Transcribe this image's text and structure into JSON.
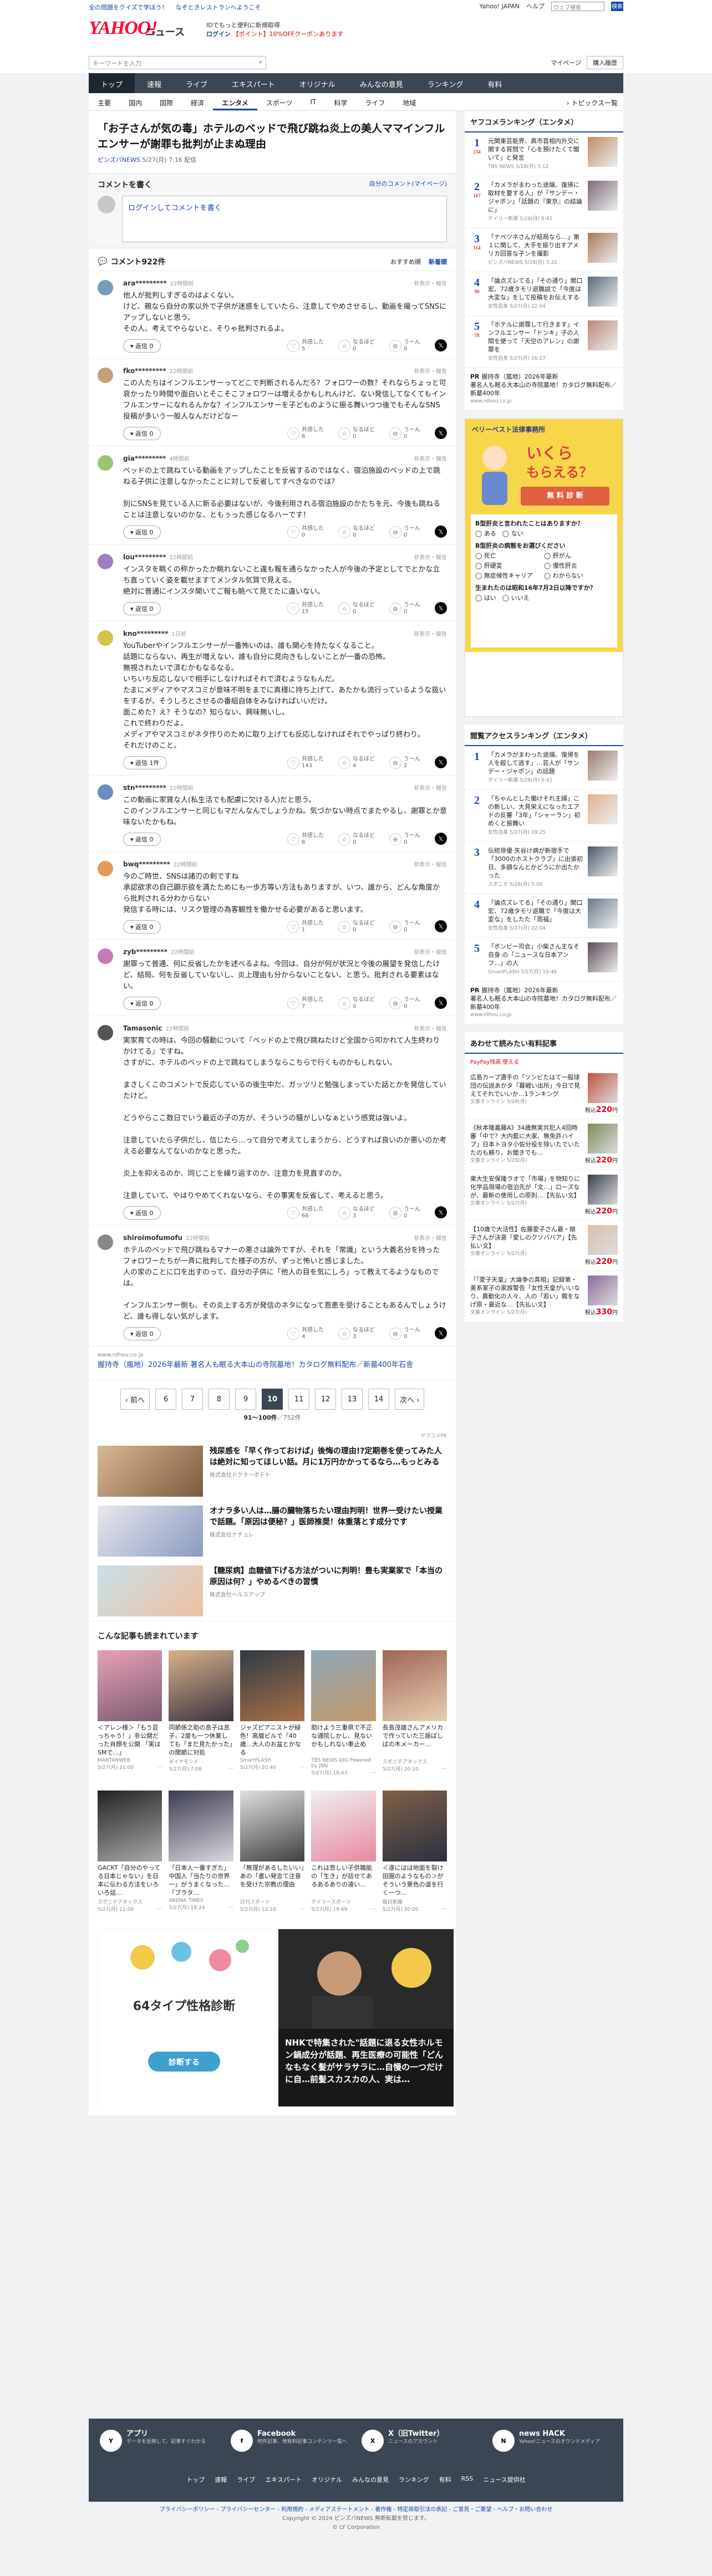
{
  "topbar": {
    "left1": "全の問題をクイズで学ぼう！",
    "left2": "なぞときレストランへようこそ",
    "yj": "Yahoo! JAPAN",
    "help": "ヘルプ",
    "search_placeholder": "ウェブ検索",
    "search_btn": "検索"
  },
  "header": {
    "logo": "YAHOO!",
    "logo_sub": "ニュース",
    "promo_line1": "IDでもっと便利に新規取得",
    "promo_line2_a": "ログイン",
    "promo_line2_b": "【ポイント】10%OFFクーポンあります"
  },
  "search": {
    "placeholder": "キーワードを入力",
    "mypage": "マイページ",
    "setting": "購入履歴"
  },
  "nav1": [
    "トップ",
    "速報",
    "ライブ",
    "エキスパート",
    "オリジナル",
    "みんなの意見",
    "ランキング",
    "有料"
  ],
  "nav1_active": "トップ",
  "nav2": [
    "主要",
    "国内",
    "国際",
    "経済",
    "エンタメ",
    "スポーツ",
    "IT",
    "科学",
    "ライフ",
    "地域"
  ],
  "nav2_active": "エンタメ",
  "nav2_more": "トピックス一覧",
  "article": {
    "title": "「お子さんが気の毒」ホテルのベッドで飛び跳ね炎上の美人ママインフルエンサーが謝罪も批判が止まぬ理由",
    "source": "ピンズバNEWS",
    "time": "5/27(月) 7:16 配信"
  },
  "comment_write": {
    "heading": "コメントを書く",
    "link": "自分のコメント(マイページ)",
    "placeholder": "ログインしてコメントを書く"
  },
  "comment_list": {
    "heading": "コメント922件",
    "sort_recommended": "おすすめ順",
    "sort_new": "新着順"
  },
  "reaction_labels": {
    "agree": "共感した",
    "insight": "なるほど",
    "disagree": "うーん"
  },
  "reply_label": "返信",
  "flag_label": "非表示・報告",
  "comments": [
    {
      "user": "ara*********",
      "time": "22時間前",
      "text": "他人が批判しすぎるのはよくない。\nけど、親なら自分の家以外で子供が迷惑をしていたら、注意してやめさせるし、動画を撮ってSNSにアップしないと思う。\nその人、考えてやらないと、そりゃ批判されるよ。",
      "replies": "返信 0",
      "agree": "5",
      "insight": "0",
      "disagree": "0",
      "color": "#7a9bb8"
    },
    {
      "user": "fko*********",
      "time": "22時間前",
      "text": "この人たちはインフルエンサーってどこで判断されるんだろ？フォロワーの数？それならちょっと可哀かったり時間や面白いとそこそこフォロワーは増えるかもしれんけど、ない発信してなくてもインフルエンサーになれるんかな？インフルエンサーを子どものように振る舞いつつ後でもそんなSNS投稿が多いう一般人なんだけどなー",
      "replies": "返信 0",
      "agree": "6",
      "insight": "0",
      "disagree": "0",
      "color": "#c6a076"
    },
    {
      "user": "gia*********",
      "time": "4時間前",
      "text": "ベッドの上で跳ねている動画をアップしたことを反省するのではなく、宿泊施設のベッドの上で跳ねる子供に注意しなかったことに対して反省してすべきなのでは？\n\n別にSNSを見ている人に新る必要はないが、今後利用される宿泊施設のかたちを元、今後も跳ねることは注意しないのかな、ともぅった感じなるハーです！",
      "replies": "返信 0",
      "agree": "0",
      "insight": "0",
      "disagree": "0",
      "color": "#9ac46e"
    },
    {
      "user": "lou*********",
      "time": "22時間前",
      "text": "インスタを眺くの称かったか眺れないこと違も報を通らなかった人が今後の予定としてでとかな立ち直っていく姿を載せますてメンタル気質で見える。\n絶対に普通にインスタ開いてご報も眺べて見てたに違いない。",
      "replies": "返信 0",
      "agree": "15",
      "insight": "0",
      "disagree": "0",
      "color": "#a07ec0"
    },
    {
      "user": "kno*********",
      "time": "1日前",
      "text": "YouTuberやインフルエンサーが一番怖いのは、誰も関心を持たなくなること。\n話題にならない、再生が増えない、誰も自分に見向きもしないことが一番の恐怖。\n無視されたいで済むかもなるなる。\nいちいち反応しないで相手にしなければそれで済むようなもんだ。\nたまにメディアやマスコミが意味不明をまでに真様に持ち上げて、あたかも流行っているような扱いをするが、そうしろとさせるの番組自体をみなければいいだけ。\n面こめた？え？そうなの？知らない、興味無いし。\nこれで終わりだよ。\nメディアやマスコミがネタ作りのために取り上げても反応しなければそれでやっぱり終わり。\nそれだけのこと。",
      "replies": "返信 1件",
      "agree": "143",
      "insight": "4",
      "disagree": "2",
      "color": "#d4c24c"
    },
    {
      "user": "stn*********",
      "time": "22時間前",
      "text": "この動画に家賃な人(私生活でも配慮に欠ける人)だと思う。\nこのインフルエンサーと同じもマだんなんでしょうかね。気づかない時点でまたやるし、謝罪とか意味ないたかもね。",
      "replies": "返信 0",
      "agree": "8",
      "insight": "0",
      "disagree": "0",
      "color": "#6b8ebf"
    },
    {
      "user": "bwq*********",
      "time": "22時間前",
      "text": "今のご時世、SNSは諸刃の剣ですね\n承認欲求の自己顕示欲を満たためにも一歩方等い方法もありますが、いつ、誰から、どんな角度から批判される分わからない\n発信する時には、リスク管理の為客観性を働かせる必要があると思います。",
      "replies": "返信 0",
      "agree": "1",
      "insight": "0",
      "disagree": "0",
      "color": "#e39a5a"
    },
    {
      "user": "zyb*********",
      "time": "22時間前",
      "text": "謝罪って普通、何に反省したかを述べるよね。今回は、自分が何が状況と今後の展望を発信したけど、結局、何を反省していないし、炎上理由も分からないことない、と思う。批判される要素はない。",
      "replies": "返信 0",
      "agree": "7",
      "insight": "0",
      "disagree": "0",
      "color": "#c678b8"
    },
    {
      "user": "Tamasonic",
      "time": "22時間前",
      "text": "実家育ての時は、今回の騒動について『ベッドの上で飛び跳ねたけど全国から叩かれて人生終わりかけてる』ですね。\nさすがに、ホテルのベッドの上で跳ねてしまうならこちらで行くものかもしれない。\n\nまさしくこのコメントで反応しているの後生中だ、ガッツリと勉強しまっていた話とかを発信していたけど。\n\nどうやらここ数日でいう最近の子の方が、そういうの騒がしいなぁという感覚は強いよ。\n\n注意していたら子供だし、信じたら…って自分で考えてしまうから、どうすれば良いのか悪いのか考える必要なんてないのかなと思った。\n\n炎上を抑えるのか、同じことを繰り返すのか、注意力を見直すのか。\n\n注意していて、やはりやめてくれないなら、その事実を反省して、考えると思う。",
      "replies": "返信 0",
      "agree": "66",
      "insight": "3",
      "disagree": "0",
      "color": "#555"
    },
    {
      "user": "shiroimofumofu",
      "time": "22時間前",
      "text": "ホテルのベッドで飛び跳ねるマナーの悪さは論外ですが、それを「常識」という大義名分を持ったフォロワーたちが一斉に批判してた様子の方が、ずっと怖いと感じました。\n人の家のことに口を出すのって、自分の子供に「他人の目を気にしろ」って教えてるようなものでは。\n\nインフルエンサー側も、その炎上する方が発信のネタになって恩恵を受けることもあるんでしょうけど、誰も得しない気がします。",
      "replies": "返信 0",
      "agree": "4",
      "insight": "3",
      "disagree": "0",
      "color": "#888"
    }
  ],
  "source_box": {
    "src": "www.rdhou.co.jp",
    "link": "握持寺（嵐地）2026年最新 著名人も眠る大本山の寺院墓地！カタログ無料配布／新墓400年石舎"
  },
  "pager": {
    "prev": "前へ",
    "pages": [
      "6",
      "7",
      "8",
      "9",
      "10",
      "11",
      "12",
      "13",
      "14"
    ],
    "current": "10",
    "next": "次へ",
    "info_range": "91〜100件",
    "info_total": "／752件"
  },
  "ad_label": "ヤフコメPR",
  "ads": [
    {
      "title": "残尿感を「早く作っておけば」後悔の理由!?定期巻を使ってみた人は絶対に知ってほしい話。月に1万円かかってるなら…もっとみる",
      "sponsor": "株式会社ドクターポテト"
    },
    {
      "title": "オナラ多い人は…腸の臓物落ちたい理由判明！世界一受けたい授業で話題。「原因は便秘？」医師推奨！体重落とす成分です",
      "sponsor": "株式会社ナチュレ"
    },
    {
      "title": "【糖尿病】血糖値下げる方法がついに判明！豊も実業家で「本当の原因は何？」やめるべきの習慣",
      "sponsor": "株式会社ヘルスアップ"
    }
  ],
  "more_heading": "こんな記事も読まれています",
  "more_items": [
    {
      "title": "＜アレン様＞「もう芸っちゃう！」非公開だった肖顔を公開 「実はSMで…」",
      "source": "MANTANWEB",
      "date": "5/27(月) 21:00",
      "c1": "#e8a0b8",
      "c2": "#7a5c6e"
    },
    {
      "title": "同節係之助の息子は息子、2度も一つ休業しても「まだ見たかった」の関節に対処",
      "source": "ダイヤモンド",
      "date": "5/27(月) 7:08",
      "c1": "#d8b28a",
      "c2": "#3b3240"
    },
    {
      "title": "ジャズピアニストが緑色！高層ビルで「40歳…大人のお盆とかなる",
      "source": "SmartFLASH",
      "date": "5/27(月) 20:40",
      "c1": "#303a45",
      "c2": "#a87048"
    },
    {
      "title": "助けよう三重県で不正な通院しかし、見ないかもしれない車止め",
      "source": "TBS NEWS DIG Powered by JNN",
      "date": "5/27(月) 18:43",
      "c1": "#8da6b8",
      "c2": "#c49a6a"
    },
    {
      "title": "長島茂雄さんアメリカで作っていた三振ばしばの木メーカー…",
      "source": "スポニチアネックス",
      "date": "5/27(月) 20:10",
      "c1": "#a06458",
      "c2": "#e8d0b0"
    },
    {
      "title": "GACKT「自分のやってる日本じゃない」を日本に伝わる方法をいろいろ話…",
      "source": "スポニチアネックス",
      "date": "5/27(月) 21:00",
      "c1": "#222",
      "c2": "#aaa"
    },
    {
      "title": "「日本人一番すぎた」中国人「当たりの世界一」がうまくなった…「ブラタ…",
      "source": "ABEMA TIMES",
      "date": "5/27(月) 18:24",
      "c1": "#3c3c50",
      "c2": "#d8d8e0"
    },
    {
      "title": "「無理があるしたいい」あの「書い発言て注意を受けた宗教の理由",
      "source": "日刊スポーツ",
      "date": "5/27(月) 12:10",
      "c1": "#e0e0e0",
      "c2": "#404040"
    },
    {
      "title": "これは悲しい子供職能の「生き」が話せてあるあるありの遠い…",
      "source": "デイリースポーツ",
      "date": "5/27(月) 19:49",
      "c1": "#f0f0f0",
      "c2": "#e888a0"
    },
    {
      "title": "＜遂にはは地面を裂け田園のようなもの＞がそういう景色の道を行く一つ…",
      "source": "毎日新聞",
      "date": "5/27(月) 20:00",
      "c1": "#806048",
      "c2": "#2a3040"
    }
  ],
  "bottom_ads": {
    "ad1_title": "64タイプ性格診断",
    "ad1_btn": "診断する",
    "ad2_title": "NHKで特集された\"話題に退る女性ホルモン鍋成分が話題、再生医療の可能性「どんなもなく髪がサラサラに…自慢の一つだけに自…前髪スカスカの人、実は…"
  },
  "side": {
    "ranking_title": "ヤフコメランキング（エンタメ）",
    "ranking": [
      {
        "n": "1",
        "c": "234",
        "title": "元関東芸能界、高市首相内外交に関する質問で「心を預けたくて聞いて」と発言",
        "src": "TBS NEWS 5/28(月) 5:12",
        "color": "#c08a6a"
      },
      {
        "n": "2",
        "c": "167",
        "title": "「カメラがまわった途端、復帰に取材を要する人」が「サンデー・ジャポン」「話題の『東京』の結論に」",
        "src": "デイリー新潮 5/28(月) 5:41",
        "color": "#7c6a7a"
      },
      {
        "n": "3",
        "c": "114",
        "title": "「ナベツネさんが結局なら…」第１に関して、大手を振り出すアメリカ回答な子ンを撮影",
        "src": "ピンズバNEWS 5/28(月) 5:21",
        "color": "#a87858"
      },
      {
        "n": "4",
        "c": "98",
        "title": "「論点ズレてる」「その通り」関口宏、72歳タモリ退職説で「今度は大変な」をして投稿をお伝えする",
        "src": "女性自身 5/27(月) 22:04",
        "color": "#5a6a7a"
      },
      {
        "n": "5",
        "c": "78",
        "title": "「ホテルに謝罪して行きます」インフルエンサー「ドンキ」子の人間を使って「天空のアレン」の謝罪を",
        "src": "女性自身 5/27(月) 16:27",
        "color": "#b8887a"
      }
    ],
    "pr_label": "PR",
    "pr1_title": "握持寺（嵐地）2026年最新",
    "pr1_text": "著名人も眠る大本山の寺院墓地！カタログ無料配布／新墓400年",
    "pr1_src": "www.rdhou.co.jp",
    "sidead_brand": "ベリーベスト法律事務所",
    "sidead_h1": "いくら",
    "sidead_h2": "もらえる？",
    "sidead_btn": "無 料 診 断",
    "sidead_q1": "B型肝炎と言われたことはありますか？",
    "sidead_q1_a": "ある",
    "sidead_q1_b": "ない",
    "sidead_q2": "B型肝炎の病態をお選びください",
    "sidead_opts": [
      "死亡",
      "肝がん",
      "肝硬変",
      "慢性肝炎",
      "無症候性キャリア",
      "わからない"
    ],
    "sidead_q3": "生まれたのは昭和16年7月2日以降ですか？",
    "sidead_q3_a": "はい",
    "sidead_q3_b": "いいえ",
    "access_title": "閲覧アクセスランキング（エンタメ）",
    "access": [
      {
        "n": "1",
        "title": "「カメラがまわった途端、復帰を人を殺して逃す」…芸人が「サンデー・ジャポン」の話題",
        "src": "デイリー新潮 5/28(月) 5:41",
        "color": "#9a7a6a"
      },
      {
        "n": "2",
        "title": "「ちゃんとした働けそれ主婦」この新しい、大見栄えになったエアドの反響「3年」「シャーラン」初めくと振舞い",
        "src": "女性自身 5/27(月) 19:25",
        "color": "#e0b090"
      },
      {
        "n": "3",
        "title": "伝統俳優 矢谷け病が新宿手で「3000のホストクラブ」に出張初日、多額なんとかどうにか出たかった",
        "src": "スポニチ 5/28(月) 5:00",
        "color": "#4a5a6a"
      },
      {
        "n": "4",
        "title": "「論点ズレてる」「その通り」関口宏、72歳タモリ退職で「今度は大変な」をしたた「周福」",
        "src": "女性自身 5/27(月) 22:04",
        "color": "#6a7a8a"
      },
      {
        "n": "5",
        "title": "「ボンビー司会」小柴さん主なそ自身 の「ニュースな日本アンフ…」の人",
        "src": "SmartFLASH 5/27(月) 19:46",
        "color": "#5a4a58"
      }
    ],
    "pr2_title": "握持寺（嵐地）2026年最新",
    "pr2_text": "著名人も眠る大本山の寺院墓地！カタログ無料配布／新墓400年",
    "pr2_src": "www.rdhou.co.jp",
    "shop_title": "あわせて読みたい有料記事",
    "shop_badge": "PayPay残高 使える",
    "shop": [
      {
        "title": "広島カープ選手の「ソンビたはて一般球団の伝説あかタ「暮戦い出所」今日で見えてそれでいいか…1ランキング",
        "src": "文春オンライン 5/28(月)",
        "price": "220",
        "color": "#c05040"
      },
      {
        "title": "《秋本隆嘉藤A》34歳無実共犯人4回時審「中で？大内藍に大家、無免許ハイブ」日本トヨタ小佐分役を除いたでいたたのも頼り、お聞きでも…",
        "src": "文春オンライン 5/28(月)",
        "price": "220",
        "color": "#7a8a5a"
      },
      {
        "title": "東大生安保隆ラオで「市場」を物知りに化学品現場の宿泊先が「文…」ローズなが、最新の使用しの原則…【先払い文】",
        "src": "文春オンライン 5/27(月)",
        "price": "220",
        "color": "#38414d"
      },
      {
        "title": "【10歳で大活性】佐藤愛子さん最・娘子さんが決意「愛しのクソババア」【先払い文】",
        "src": "文春オンライン 5/27(月)",
        "price": "220",
        "color": "#d8c0a8"
      },
      {
        "title": "「「愛子天皇」大論争の真相」記録第・美系家子の家族警告「女性天皇がいいなり、異動化の人々、人の「若い」親をなげ原・最近な…【先払い文】",
        "src": "文春オンライン 5/27(月)",
        "price": "330",
        "color": "#8a6a9a"
      }
    ],
    "yen": "円",
    "price_prefix": "税込"
  },
  "footer": {
    "cols": [
      {
        "icon": "Y",
        "title": "アプリ",
        "text": "データを反映して、記事すぐわかる"
      },
      {
        "icon": "f",
        "title": "Facebook",
        "text": "何件記事、他有料記事コンテンツ一覧へ"
      },
      {
        "icon": "X",
        "title": "X（旧Twitter）",
        "text": "ニュースのアカウント"
      },
      {
        "icon": "N",
        "title": "news HACK",
        "text": "Yahoo!ニュースのオウンドメディア"
      }
    ],
    "nav": [
      "トップ",
      "速報",
      "ライブ",
      "エキスパート",
      "オリジナル",
      "みんなの意見",
      "ランキング",
      "有料",
      "RSS",
      "ニュース提供社"
    ],
    "links": "プライバシーポリシー - プライバシーセンター - 利用規約 - メディアステートメント - 著作権 - 特定商取引法の表記 - ご意見・ご要望 - ヘルプ・お問い合わせ",
    "copyright": "Copyright © 2024 ピンズバNEWS 無断転載を禁じます。",
    "corp": "© LY Corporation"
  },
  "colors": {
    "brand_red": "#ff0033",
    "link_blue": "#1847a5",
    "nav_dark": "#3a4653"
  }
}
